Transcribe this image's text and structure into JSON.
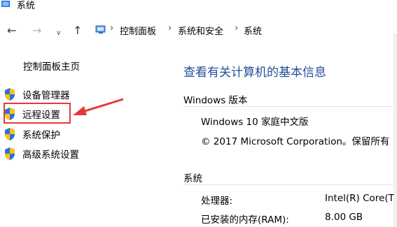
{
  "window": {
    "title": "系统"
  },
  "nav": {
    "back_icon": "left-arrow-icon",
    "forward_icon": "right-arrow-icon",
    "up_icon": "up-arrow-icon",
    "breadcrumb": [
      "控制面板",
      "系统和安全",
      "系统"
    ],
    "separator": "›"
  },
  "sidebar": {
    "home": "控制面板主页",
    "items": [
      {
        "label": "设备管理器",
        "icon": "shield-icon"
      },
      {
        "label": "远程设置",
        "icon": "shield-icon"
      },
      {
        "label": "系统保护",
        "icon": "shield-icon"
      },
      {
        "label": "高级系统设置",
        "icon": "shield-icon"
      }
    ]
  },
  "main": {
    "heading": "查看有关计算机的基本信息",
    "windows_section": {
      "title": "Windows 版本",
      "edition": "Windows 10 家庭中文版",
      "copyright": "© 2017 Microsoft Corporation。保留所有"
    },
    "system_section": {
      "title": "系统",
      "rows": [
        {
          "label": "处理器:",
          "value": "Intel(R) Core(T"
        },
        {
          "label": "已安装的内存(RAM):",
          "value": "8.00 GB"
        }
      ]
    }
  },
  "colors": {
    "heading": "#1f4e97",
    "highlight": "#e53935",
    "accent_blue": "#1e6fd9"
  }
}
